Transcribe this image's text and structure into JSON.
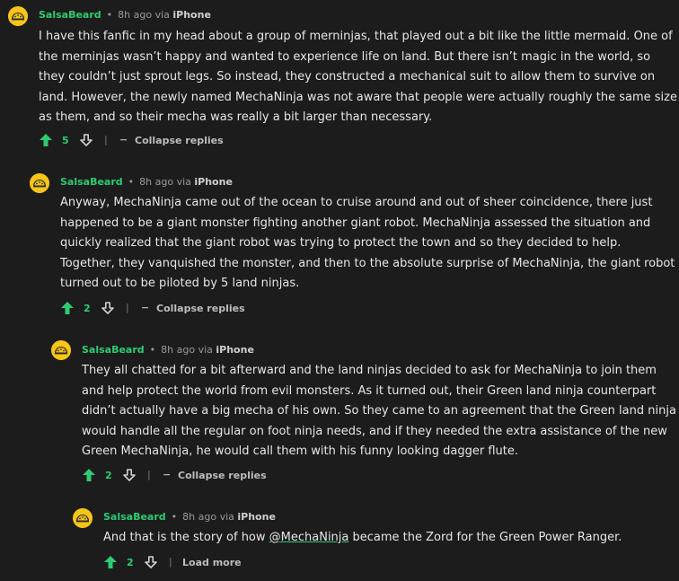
{
  "comments": [
    {
      "user": "SalsaBeard",
      "time": "8h ago",
      "via": "via",
      "device": "iPhone",
      "body": "I have this fanfic in my head about a group of merninjas, that played out a bit like the little mermaid. One of the merninjas wasn’t happy and wanted to experience life on land. But there isn’t magic in the world, so they couldn’t just sprout legs. So instead, they constructed a mechanical suit to allow them to survive on land. However, the newly named MechaNinja was not aware that people were actually roughly the same size as them, and so their mecha was really a bit larger than necessary.",
      "score": "5",
      "action_label": "Collapse replies"
    },
    {
      "user": "SalsaBeard",
      "time": "8h ago",
      "via": "via",
      "device": "iPhone",
      "body": "Anyway, MechaNinja came out of the ocean to cruise around and out of sheer coincidence, there just happened to be a giant monster fighting another giant robot. MechaNinja assessed the situation and quickly realized that the giant robot was trying to protect the town and so they decided to help. Together, they vanquished the monster, and then to the absolute surprise of MechaNinja, the giant robot turned out to be piloted by 5 land ninjas.",
      "score": "2",
      "action_label": "Collapse replies"
    },
    {
      "user": "SalsaBeard",
      "time": "8h ago",
      "via": "via",
      "device": "iPhone",
      "body": "They all chatted for a bit afterward and the land ninjas decided to ask for MechaNinja to join them and help protect the world from evil monsters. As it turned out, their Green land ninja counterpart didn’t actually have a big mecha of his own. So they came to an agreement that the Green land ninja would handle all the regular on foot ninja needs, and if they needed the extra assistance of the new Green MechaNinja, he would call them with his funny looking dagger flute.",
      "score": "2",
      "action_label": "Collapse replies"
    },
    {
      "user": "SalsaBeard",
      "time": "8h ago",
      "via": "via",
      "device": "iPhone",
      "body_before": "And that is the story of how ",
      "mention": "@MechaNinja",
      "body_after": " became the Zord for the Green Power Ranger.",
      "score": "2",
      "action_label": "Load more"
    }
  ],
  "ui": {
    "separator": "|",
    "collapse_dash": "−",
    "bullet": "•"
  },
  "icons": {
    "avatar": "taco-avatar-icon",
    "upvote": "upvote-arrow-icon",
    "downvote": "downvote-arrow-icon"
  },
  "colors": {
    "background": "#1c1c1c",
    "username": "#2ecc71",
    "upvote": "#2ecc71",
    "avatar_bg": "#f5c518"
  }
}
